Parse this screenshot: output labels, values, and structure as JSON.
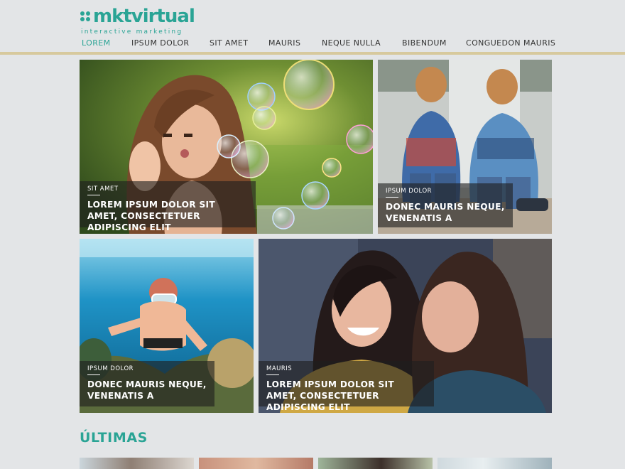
{
  "brand": {
    "name": "mktvirtual",
    "tagline": "interactive marketing",
    "color": "#2aa495"
  },
  "nav": {
    "items": [
      {
        "label": "LOREM",
        "active": true
      },
      {
        "label": "IPSUM DOLOR",
        "active": false
      },
      {
        "label": "SIT AMET",
        "active": false
      },
      {
        "label": "MAURIS",
        "active": false
      },
      {
        "label": "NEQUE NULLA",
        "active": false
      },
      {
        "label": "BIBENDUM",
        "active": false
      },
      {
        "label": "CONGUEDON MAURIS",
        "active": false
      }
    ],
    "rule_color": "#d7c99d"
  },
  "featured": [
    {
      "category": "SIT AMET",
      "title": "LOREM IPSUM DOLOR SIT AMET, CONSECTETUER ADIPISCING ELIT",
      "image": "woman blowing soap bubbles"
    },
    {
      "category": "IPSUM DOLOR",
      "title": "DONEC MAURIS NEQUE, VENENATIS A",
      "image": "two boys covering faces"
    },
    {
      "category": "IPSUM DOLOR",
      "title": "DONEC MAURIS NEQUE, VENENATIS A",
      "image": "snorkeler underwater"
    },
    {
      "category": "MAURIS",
      "title": "LOREM IPSUM DOLOR SIT AMET, CONSECTETUER ADIPISCING ELIT",
      "image": "two women laughing at phone"
    }
  ],
  "latest": {
    "title": "ÚLTIMAS"
  }
}
